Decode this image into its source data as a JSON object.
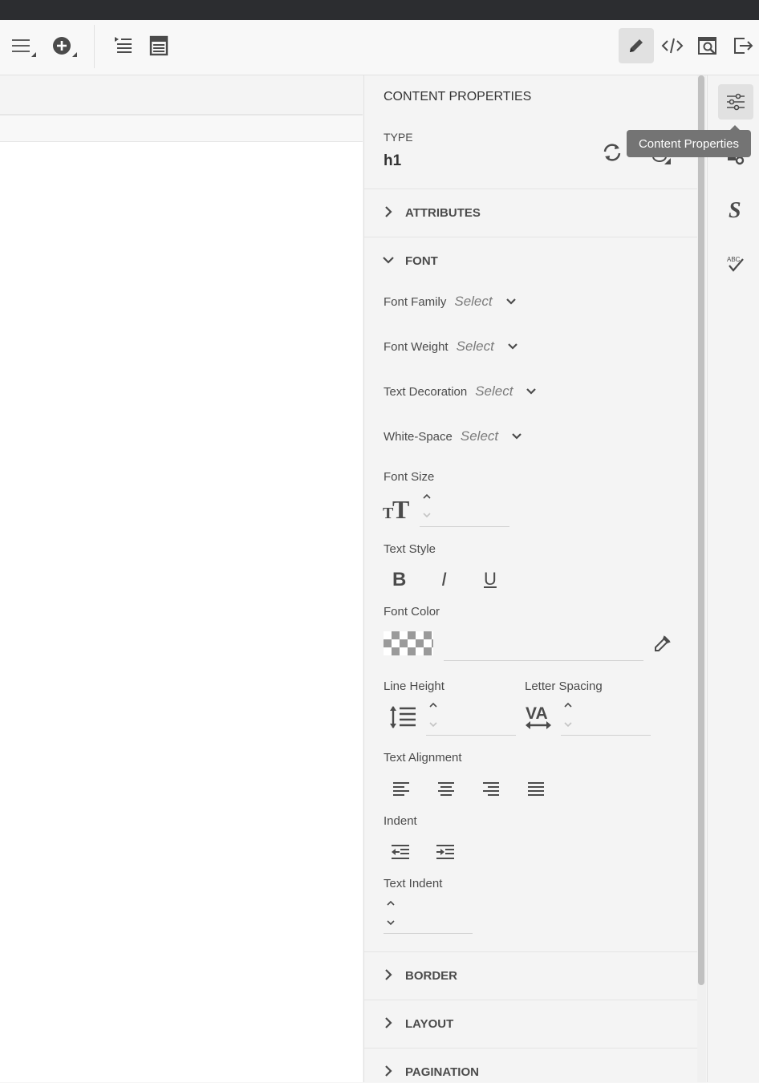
{
  "panel": {
    "title": "CONTENT PROPERTIES",
    "type_label": "TYPE",
    "type_value": "h1",
    "sections": {
      "attributes": "ATTRIBUTES",
      "font": "FONT",
      "border": "BORDER",
      "layout": "LAYOUT",
      "pagination": "PAGINATION"
    },
    "font": {
      "family_label": "Font Family",
      "family_value": "Select",
      "weight_label": "Font Weight",
      "weight_value": "Select",
      "decoration_label": "Text Decoration",
      "decoration_value": "Select",
      "whitespace_label": "White-Space",
      "whitespace_value": "Select",
      "size_label": "Font Size",
      "style_label": "Text Style",
      "bold": "B",
      "italic": "I",
      "underline": "U",
      "color_label": "Font Color",
      "line_height_label": "Line Height",
      "letter_spacing_label": "Letter Spacing",
      "alignment_label": "Text Alignment",
      "indent_label": "Indent",
      "text_indent_label": "Text Indent"
    }
  },
  "tooltip": "Content Properties",
  "icons": {
    "toolbar": [
      "menu-icon",
      "add-icon",
      "insert-list-icon",
      "document-icon",
      "edit-icon",
      "code-icon",
      "preview-icon",
      "exit-icon"
    ],
    "rail": [
      "content-properties-icon",
      "element-settings-icon",
      "styles-icon",
      "spellcheck-icon"
    ]
  }
}
